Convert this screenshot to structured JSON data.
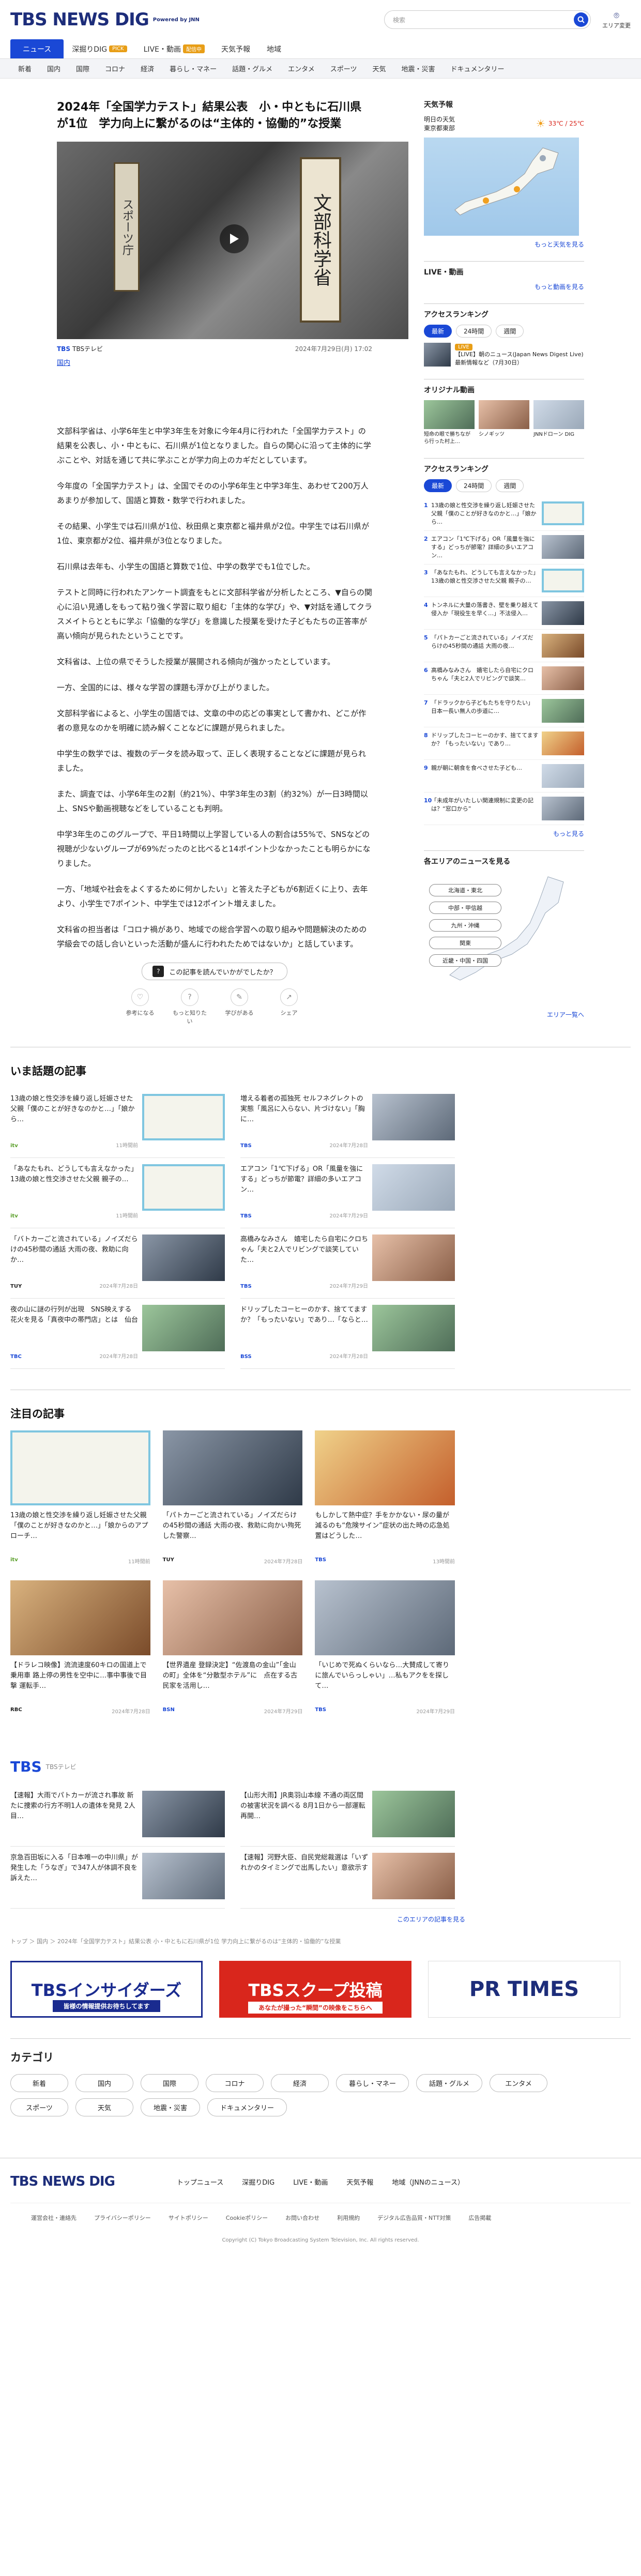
{
  "header": {
    "logo": "TBS NEWS DIG",
    "powered": "Powered by JNN",
    "search_placeholder": "検索",
    "area_label": "エリア変更"
  },
  "nav_main": [
    {
      "label": "ニュース",
      "active": true
    },
    {
      "label": "深掘りDIG",
      "badge": "PICK"
    },
    {
      "label": "LIVE・動画",
      "badge": "配信中"
    },
    {
      "label": "天気予報"
    },
    {
      "label": "地域"
    }
  ],
  "nav_sub": [
    "新着",
    "国内",
    "国際",
    "コロナ",
    "経済",
    "暮らし・マネー",
    "話題・グルメ",
    "エンタメ",
    "スポーツ",
    "天気",
    "地震・災害",
    "ドキュメンタリー"
  ],
  "article": {
    "title": "2024年「全国学力テスト」結果公表　小・中ともに石川県が1位　学力向上に繋がるのは“主体的・協働的”な授業",
    "source": "TBSテレビ",
    "date": "2024年7月29日(月) 17:02",
    "category": "国内",
    "video_sign": "文部科学省",
    "video_sign2": "スポーツ庁",
    "paragraphs": [
      "文部科学省は、小学6年生と中学3年生を対象に今年4月に行われた「全国学力テスト」の結果を公表し、小・中ともに、石川県が1位となりました。自らの関心に沿って主体的に学ぶことや、対話を通じて共に学ぶことが学力向上のカギだとしています。",
      "今年度の「全国学力テスト」は、全国でそのの小学6年生と中学3年生、あわせて200万人あまりが参加して、国語と算数・数学で行われました。",
      "その結果、小学生では石川県が1位、秋田県と東京都と福井県が2位。中学生では石川県が1位、東京都が2位、福井県が3位となりました。",
      "石川県は去年も、小学生の国語と算数で1位、中学の数学でも1位でした。",
      "テストと同時に行われたアンケート調査をもとに文部科学省が分析したところ、▼自らの関心に沿い見通しをもって粘り強く学習に取り組む「主体的な学び」や、▼対話を通してクラスメイトらとともに学ぶ「協働的な学び」を意識した授業を受けた子どもたちの正答率が高い傾向が見られたということです。",
      "文科省は、上位の県でそうした授業が展開される傾向が強かったとしています。",
      "一方、全国的には、様々な学習の課題も浮かび上がりました。",
      "文部科学省によると、小学生の国語では、文章の中の応どの事実として書かれ、どこが作者の意見なのかを明確に読み解くことなどに課題が見られました。",
      "中学生の数学では、複数のデータを読み取って、正しく表現することなどに課題が見られました。",
      "また、調査では、小学6年生の2割（約21%）、中学3年生の3割（約32%）が一日3時間以上、SNSや動画視聴などをしていることも判明。",
      "中学3年生のこのグループで、平日1時間以上学習している人の割合は55%で、SNSなどの視聴が少ないグループが69%だったのと比べると14ポイント少なかったことも明らかになりました。",
      "一方、「地域や社会をよくするために何かしたい」と答えた子どもが6割近くに上り、去年より、小学生で7ポイント、中学生では12ポイント増えました。",
      "文科省の担当者は「コロナ禍があり、地域での総合学習への取り組みや問題解決のための学級会での話し合いといった活動が盛んに行われたためではないか」と話しています。"
    ],
    "feedback_question": "この記事を読んでいかがでしたか？",
    "feedback_options": [
      "参考になる",
      "もっと知りたい",
      "学びがある",
      "シェア"
    ]
  },
  "trending": {
    "title": "いま話題の記事",
    "items": [
      {
        "text": "13歳の娘と性交渉を繰り返し妊娠させた父親「僕のことが好きなのかと…」「娘から…",
        "source": "itv",
        "date": "11時間前"
      },
      {
        "text": "増える着者の孤独死 セルフネグレクトの実態「風呂に入らない、片づけない」「胸に…",
        "source": "TBS",
        "date": "2024年7月28日"
      },
      {
        "text": "「あなたもれ、どうしても言えなかった」13歳の娘と性交渉させた父親 親子の…",
        "source": "itv",
        "date": "11時間前"
      },
      {
        "text": "エアコン「1℃下げる」OR「風量を強にする」どっちが節電？詳細の多いエアコン…",
        "source": "TBS",
        "date": "2024年7月29日"
      },
      {
        "text": "「バトカーごと流されている」ノイズだらけの45秒間の通話 大雨の夜、救助に向か…",
        "source": "TUY",
        "date": "2024年7月28日"
      },
      {
        "text": "高橋みなみさん　嬉宅したら自宅にクロちゃん「夫と2人でリビングで談笑していた…",
        "source": "TBS",
        "date": "2024年7月29日"
      },
      {
        "text": "夜の山に謎の行列が出現　SNS映えする花火を見る「真夜中の帯門店」とは　仙台",
        "source": "TBC",
        "date": "2024年7月28日"
      },
      {
        "text": "ドリップしたコーヒーのかす、捨ててますか？「もったいない」であり…「ならと…",
        "source": "BSS",
        "date": "2024年7月28日"
      }
    ]
  },
  "featured": {
    "title": "注目の記事",
    "items": [
      {
        "text": "13歳の娘と性交渉を繰り返し妊娠させた父親「僕のことが好きなのかと…」「娘からのアプローチ…",
        "source": "itv",
        "date": "11時間前"
      },
      {
        "text": "「パトカーごと流されている」ノイズだらけの45秒間の通話 大雨の夜、救助に向かい殉死した警察…",
        "source": "TUY",
        "date": "2024年7月28日"
      },
      {
        "text": "もしかして熱中症？手をかかない・尿の量が減るのも“危険サイン”症状の出た時の応急処置はどうした…",
        "source": "TBS",
        "date": "13時間前"
      },
      {
        "text": "【ドラレコ映像】流流速度60キロの国道上で乗用車 路上停の男性を空中に…事中事後で目撃 運転手…",
        "source": "RBC",
        "date": "2024年7月28日"
      },
      {
        "text": "【世界遺産 登録決定】“佐渡島の金山”「金山の町」全体を“分散型ホテル”に　点在する古民家を活用し…",
        "source": "BSN",
        "date": "2024年7月29日"
      },
      {
        "text": "「いじめで死ぬくらいなら…大賛成して寄りに旅んでいらっしゃい」…私もアクをを探して…",
        "source": "TBS",
        "date": "2024年7月29日"
      }
    ]
  },
  "tbs_section": {
    "title": "TBS",
    "subtitle": "TBSテレビ",
    "items": [
      {
        "text": "【速報】大雨でパトカーが流され事故 新たに捜索の行方不明1人の遺体を発見 2人目…"
      },
      {
        "text": "【山形大雨】JR奥羽山本線 不通の両区間の被害状況を調べる 8月1日から一部運転再開…"
      },
      {
        "text": "京急百田坂に入る「日本唯一の中川県」が発生した「うなぎ」で347人が体調不良を訴えた…"
      },
      {
        "text": "【速報】河野大臣、自民党総裁選は「いずれかのタイミングで出馬したい」意欲示す"
      }
    ],
    "more_label": "このエリアの記事を見る"
  },
  "breadcrumb": "トップ ＞ 国内 ＞ 2024年「全国学力テスト」結果公表 小・中ともに石川県が1位 学力向上に繋がるのは“主体的・協働的”な授業",
  "banners": [
    {
      "title": "TBSインサイダーズ",
      "caption": "皆様の情報提供お待ちしてます"
    },
    {
      "title": "TBSスクープ投稿",
      "caption": "あなたが撮った“瞬間”の映像をこちらへ"
    },
    {
      "title": "PR TIMES",
      "caption": ""
    }
  ],
  "categories": {
    "title": "カテゴリ",
    "items": [
      "新着",
      "国内",
      "国際",
      "コロナ",
      "経済",
      "暮らし・マネー",
      "話題・グルメ",
      "エンタメ",
      "スポーツ",
      "天気",
      "地震・災害",
      "ドキュメンタリー"
    ]
  },
  "footer": {
    "logo": "TBS NEWS DIG",
    "links": [
      "トップニュース",
      "深掘りDIG",
      "LIVE・動画",
      "天気予報",
      "地域（JNNのニュース）"
    ],
    "sub_links": [
      "運営会社・連絡先",
      "プライバシーポリシー",
      "サイトポリシー",
      "Cookieポリシー",
      "お問い合わせ",
      "利用規約",
      "デジタル広告品質・NTT対策",
      "広告掲載"
    ],
    "copyright": "Copyright (C) Tokyo Broadcasting System Television, Inc. All rights reserved."
  },
  "sidebar": {
    "weather_title": "天気予報",
    "weather_day": "明日の天気",
    "weather_city": "東京都東部",
    "weather_temp": "33℃ / 25℃",
    "weather_more": "もっと天気を見る",
    "live_title": "LIVE・動画",
    "live_more": "もっと動画を見る",
    "live_badge": "LIVE",
    "live_caption": "【LIVE】朝のニュース(Japan News Digest Live) 最新情報など（7月30日）",
    "ranking_title": "アクセスランキング",
    "ranking_tabs": [
      "最新",
      "24時間",
      "週間"
    ],
    "original_title": "オリジナル動画",
    "original_items": [
      {
        "text": "短命の眼で勝ちながら行った村上…"
      },
      {
        "text": "シノギッツ"
      },
      {
        "text": "JNNドローン DIG"
      }
    ],
    "ranking_items": [
      {
        "text": "13歳の娘と性交渉を繰り返し妊娠させた父親「僕のことが好きなのかと…」「娘から…"
      },
      {
        "text": "エアコン「1℃下げる」OR「風量を強にする」どっちが節電？詳細の多いエアコン…"
      },
      {
        "text": "「あなたもれ、どうしても言えなかった」13歳の娘と性交渉させた父親 親子の…"
      },
      {
        "text": "トンネルに大量の落書き、壁を乗り越えて侵入か「現役生を早く…」不法侵入…"
      },
      {
        "text": "「パトカーごと流されている」ノイズだらけの45秒間の通話 大雨の夜…"
      },
      {
        "text": "高橋みなみさん　嬉宅したら自宅にクロちゃん「夫と2人でリビングで談笑…"
      },
      {
        "text": "「ドラックから子どもたちを守りたい」日本一長い無人の歩道に…"
      },
      {
        "text": "ドリップしたコーヒーのかす、捨ててますか？「もったいない」であり…"
      },
      {
        "text": "親が朝に朝食を食べさせた子ども…"
      },
      {
        "text": "「未成年がいたしい関連規制に変更の記は？“窓口から”"
      }
    ],
    "ranking_more": "もっと見る",
    "region_title": "各エリアのニュースを見る",
    "regions": [
      "北海道・東北",
      "中部・甲信越",
      "九州・沖縄",
      "関東",
      "近畿・中国・四国"
    ],
    "region_more": "エリア一覧へ"
  },
  "colors": {
    "brand": "#1d2d7a",
    "accent": "#1a48d6",
    "badge": "#e89e17",
    "red": "#d9261c"
  }
}
